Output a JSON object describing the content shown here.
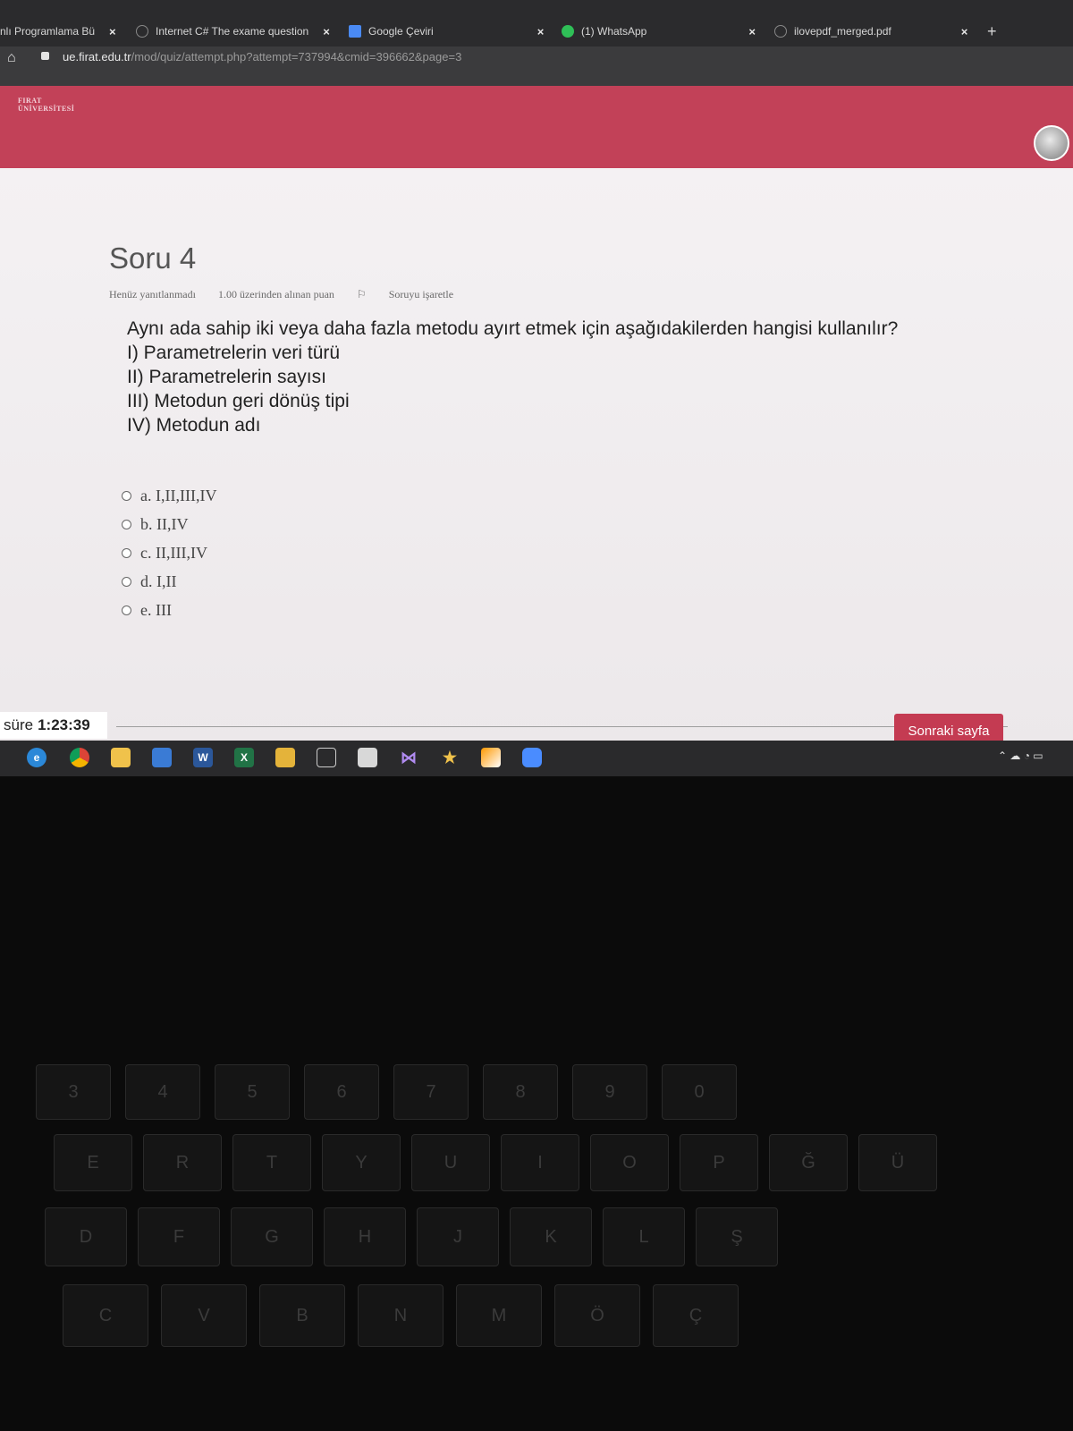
{
  "browser": {
    "tabs": [
      {
        "label": "nlı Programlama Bü",
        "close": "×"
      },
      {
        "label": "Internet C# The exame question",
        "close": "×"
      },
      {
        "label": "Google Çeviri",
        "close": "×"
      },
      {
        "label": "(1) WhatsApp",
        "close": "×"
      },
      {
        "label": "ilovepdf_merged.pdf",
        "close": "×"
      }
    ],
    "new_tab": "+",
    "url_domain": "ue.firat.edu.tr",
    "url_path": "/mod/quiz/attempt.php?attempt=737994&cmid=396662&page=3"
  },
  "site": {
    "logo_line1": "FIRAT",
    "logo_line2": "ÜNİVERSİTESİ"
  },
  "question": {
    "title": "Soru 4",
    "status": "Henüz yanıtlanmadı",
    "points": "1.00 üzerinden alınan puan",
    "flag_label": "Soruyu işaretle",
    "text": "Aynı ada sahip iki veya daha fazla metodu ayırt etmek için aşağıdakilerden hangisi kullanılır?",
    "items": [
      "I) Parametrelerin veri türü",
      "II) Parametrelerin sayısı",
      "III) Metodun geri dönüş tipi",
      "IV) Metodun adı"
    ],
    "answers": [
      "a. I,II,III,IV",
      "b. II,IV",
      "c. II,III,IV",
      "d. I,II",
      "e. III"
    ]
  },
  "footer": {
    "timer_label": "süre",
    "timer_value": "1:23:39",
    "next_button": "Sonraki sayfa"
  },
  "colors": {
    "brand": "#c24158",
    "button": "#c43b52"
  },
  "taskbar_icons": [
    "edge-icon",
    "chrome-icon",
    "file-explorer-icon",
    "calendar-icon",
    "word-icon",
    "excel-icon",
    "folder-icon",
    "window-icon",
    "cube-icon",
    "visual-studio-icon",
    "star-icon",
    "sublime-icon",
    "zoom-icon"
  ],
  "keyboard": {
    "row1": [
      "3",
      "4",
      "5",
      "6",
      "7",
      "8",
      "9",
      "0"
    ],
    "row2": [
      "E",
      "R",
      "T",
      "Y",
      "U",
      "I",
      "O",
      "P",
      "Ğ",
      "Ü"
    ],
    "row3": [
      "D",
      "F",
      "G",
      "H",
      "J",
      "K",
      "L",
      "Ş"
    ],
    "row4": [
      "C",
      "V",
      "B",
      "N",
      "M",
      "Ö",
      "Ç"
    ]
  }
}
